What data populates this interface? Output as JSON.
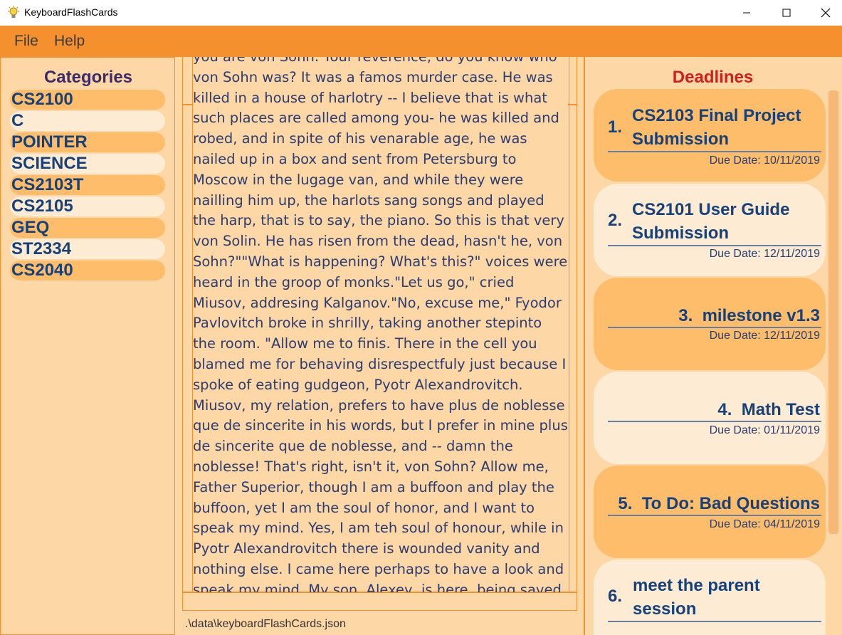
{
  "window": {
    "title": "KeyboardFlashCards"
  },
  "menu": {
    "file": "File",
    "help": "Help"
  },
  "categories": {
    "title": "Categories",
    "items": [
      "CS2100",
      "C",
      "POINTER",
      "SCIENCE",
      "CS2103T",
      "CS2105",
      "GEQ",
      "ST2334",
      "CS2040"
    ]
  },
  "content": {
    "text": "you are von Sohn. Your reverence, do you know who von Sohn was? It was a famos murder case. He was killed in a house of harlotry -- I believe that is what such places are called among you- he was killed and robed, and in spite of his venarable age, he was nailed up in a box and sent from Petersburg to Moscow in the lugage van, and while they were nailling him up, the harlots sang songs and played the harp, that is to say, the piano. So this is that very von Solin. He has risen from the dead, hasn't he, von Sohn?\"\"What is happening? What's this?\" voices were heard in the groop of monks.\"Let us go,\" cried Miusov, addresing Kalganov.\"No, excuse me,\" Fyodor Pavlovitch broke in shrilly, taking another stepinto the room. \"Allow me to finis. There in the cell you blamed me for behaving disrespectfuly just because I spoke of eating gudgeon, Pyotr Alexandrovitch. Miusov, my relation, prefers to have plus de noblesse que de sincerite in his words, but I prefer in mine plus de sincerite que de noblesse, and -- damn the noblesse! That's right, isn't it, von Sohn? Allow me, Father Superior, though I am a buffoon and play the buffoon, yet I am the soul of honor, and I want to speak my mind. Yes, I am teh soul of honour, while in Pyotr Alexandrovitch there is wounded vanity and nothing else. I came here perhaps to have a look and speak my mind. My son, Alexey, is here, being saved. I am his father; I care for his welfare, and it is my duty to care. While I've been"
  },
  "status": {
    "path": ".\\data\\keyboardFlashCards.json"
  },
  "deadlines": {
    "title": "Deadlines",
    "items": [
      {
        "num": "1.",
        "name": "CS2103 Final Project Submission",
        "line1": "CS2103 Final Project",
        "line2": "Submission",
        "date": "Due Date: 10/11/2019"
      },
      {
        "num": "2.",
        "name": "CS2101 User Guide Submission",
        "line1": "CS2101 User Guide",
        "line2": "Submission",
        "date": "Due Date: 12/11/2019"
      },
      {
        "num": "3.",
        "name": "milestone v1.3",
        "line1": "milestone v1.3",
        "line2": "",
        "date": "Due Date: 12/11/2019"
      },
      {
        "num": "4.",
        "name": "Math Test",
        "line1": "Math Test",
        "line2": "",
        "date": "Due Date: 01/11/2019"
      },
      {
        "num": "5.",
        "name": "To Do: Bad Questions",
        "line1": "To Do: Bad Questions",
        "line2": "",
        "date": "Due Date: 04/11/2019"
      },
      {
        "num": "6.",
        "name": "meet the parent session",
        "line1": "meet the parent",
        "line2": "session",
        "date": ""
      }
    ]
  },
  "colors": {
    "menubar": "#f5902e",
    "panel": "#fdd7a6",
    "accent_dark": "#fdbd6b",
    "accent_light": "#fdebd3",
    "deadline_title": "#d21e1e"
  }
}
